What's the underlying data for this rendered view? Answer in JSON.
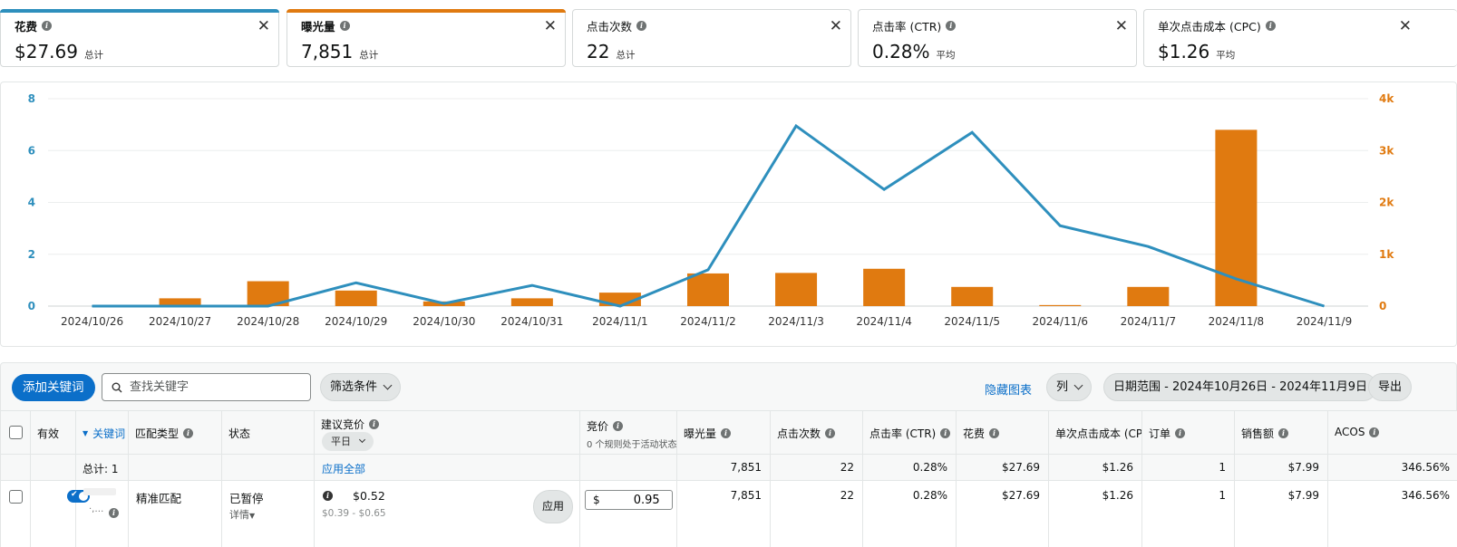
{
  "metrics": [
    {
      "title": "花费",
      "value": "$27.69",
      "sub": "总计",
      "color": "#2e8fbd",
      "selected": true
    },
    {
      "title": "曝光量",
      "value": "7,851",
      "sub": "总计",
      "color": "#e07a10",
      "selected": true
    },
    {
      "title": "点击次数",
      "value": "22",
      "sub": "总计",
      "color": "",
      "selected": false
    },
    {
      "title": "点击率 (CTR)",
      "value": "0.28%",
      "sub": "平均",
      "color": "",
      "selected": false
    },
    {
      "title": "单次点击成本 (CPC)",
      "value": "$1.26",
      "sub": "平均",
      "color": "",
      "selected": false
    }
  ],
  "chart_data": {
    "type": "bar+line",
    "categories": [
      "2024/10/26",
      "2024/10/27",
      "2024/10/28",
      "2024/10/29",
      "2024/10/30",
      "2024/10/31",
      "2024/11/1",
      "2024/11/2",
      "2024/11/3",
      "2024/11/4",
      "2024/11/5",
      "2024/11/6",
      "2024/11/7",
      "2024/11/8",
      "2024/11/9"
    ],
    "left_axis": {
      "ticks": [
        "0",
        "2",
        "4",
        "6",
        "8"
      ],
      "max": 8,
      "color": "#2e8fbd"
    },
    "right_axis": {
      "ticks": [
        "0",
        "1k",
        "2k",
        "3k",
        "4k"
      ],
      "max": 4000,
      "color": "#e07a10"
    },
    "series": [
      {
        "metric": "花费",
        "axis": "left",
        "kind": "line",
        "color": "#2e8fbd",
        "values": [
          0,
          0,
          0,
          0.9,
          0.1,
          0.8,
          0,
          1.4,
          6.95,
          4.5,
          6.7,
          3.1,
          2.3,
          1.05,
          0
        ]
      },
      {
        "metric": "曝光量",
        "axis": "right",
        "kind": "bar",
        "color": "#e07a10",
        "values": [
          0,
          150,
          480,
          300,
          90,
          150,
          260,
          630,
          640,
          720,
          370,
          20,
          370,
          3400,
          0
        ]
      }
    ],
    "grid": true
  },
  "toolbar": {
    "add_keyword": "添加关键词",
    "search_placeholder": "查找关键字",
    "filter": "筛选条件",
    "hide_chart": "隐藏图表",
    "columns": "列",
    "date_range": "日期范围 - 2024年10月26日 - 2024年11月9日",
    "export": "导出"
  },
  "table": {
    "headers": {
      "active": "有效",
      "keyword": "关键词",
      "match_type": "匹配类型",
      "status": "状态",
      "suggested_bid": "建议竞价",
      "suggested_bid_select": "平日",
      "bid": "竞价",
      "bid_note": "0 个规则处于活动状态",
      "impressions": "曝光量",
      "clicks": "点击次数",
      "ctr": "点击率 (CTR)",
      "spend": "花费",
      "cpc": "单次点击成本 (CPC)",
      "orders": "订单",
      "sales": "销售额",
      "acos": "ACOS"
    },
    "totals": {
      "label": "总计: 1",
      "apply_all": "应用全部",
      "impressions": "7,851",
      "clicks": "22",
      "ctr": "0.28%",
      "spend": "$27.69",
      "cpc": "$1.26",
      "orders": "1",
      "sales": "$7.99",
      "acos": "346.56%"
    },
    "row": {
      "keyword_obscured": "·,…",
      "match_type": "精准匹配",
      "status": "已暂停",
      "details": "详情",
      "suggested_bid": "$0.52",
      "suggested_range": "$0.39 - $0.65",
      "apply": "应用",
      "currency": "$",
      "bid": "0.95",
      "impressions": "7,851",
      "clicks": "22",
      "ctr": "0.28%",
      "spend": "$27.69",
      "cpc": "$1.26",
      "orders": "1",
      "sales": "$7.99",
      "acos": "346.56%"
    }
  }
}
